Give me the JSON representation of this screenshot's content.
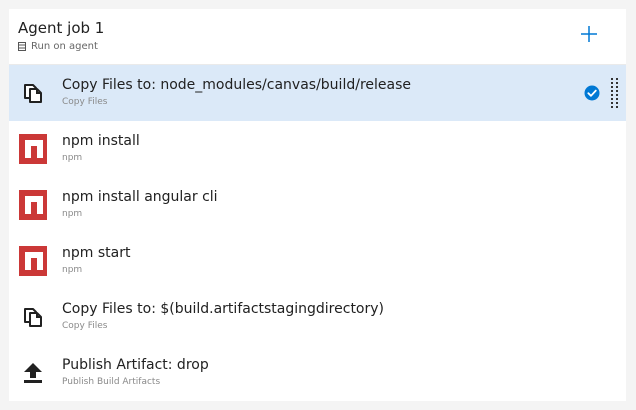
{
  "job": {
    "title": "Agent job 1",
    "subtitle": "Run on agent"
  },
  "tasks": [
    {
      "title": "Copy Files to: node_modules/canvas/build/release",
      "subtitle": "Copy Files",
      "icon": "copy-files-icon",
      "selected": true
    },
    {
      "title": "npm install",
      "subtitle": "npm",
      "icon": "npm-icon"
    },
    {
      "title": "npm install angular cli",
      "subtitle": "npm",
      "icon": "npm-icon"
    },
    {
      "title": "npm start",
      "subtitle": "npm",
      "icon": "npm-icon"
    },
    {
      "title": "Copy Files to: $(build.artifactstagingdirectory)",
      "subtitle": "Copy Files",
      "icon": "copy-files-icon"
    },
    {
      "title": "Publish Artifact: drop",
      "subtitle": "Publish Build Artifacts",
      "icon": "publish-artifact-icon"
    }
  ],
  "colors": {
    "selected_row": "#dbe9f8",
    "accent": "#0078d4",
    "npm": "#cb3837"
  }
}
